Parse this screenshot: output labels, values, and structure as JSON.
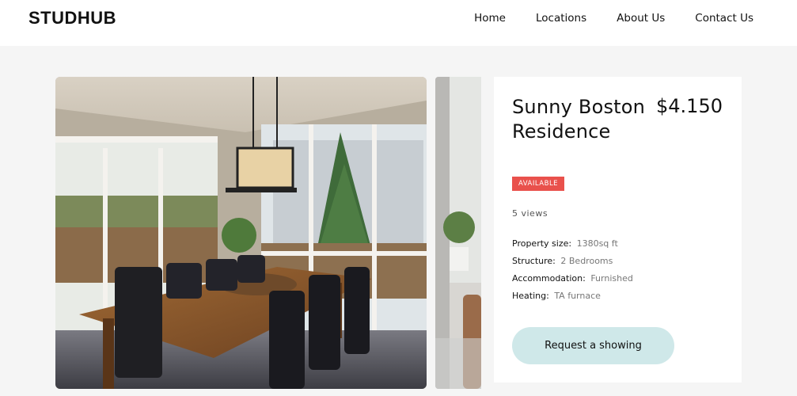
{
  "header": {
    "logo": "STUDHUB",
    "nav": [
      "Home",
      "Locations",
      "About Us",
      "Contact Us"
    ]
  },
  "listing": {
    "title": "Sunny Boston Residence",
    "price": "$4.150",
    "status": "AVAILABLE",
    "views": "5 views",
    "properties": [
      {
        "label": "Property size:",
        "value": "1380sq ft"
      },
      {
        "label": "Structure:",
        "value": "2 Bedrooms"
      },
      {
        "label": "Accommodation:",
        "value": "Furnished"
      },
      {
        "label": "Heating:",
        "value": "TA furnace"
      }
    ],
    "cta": "Request a showing"
  },
  "colors": {
    "badge": "#e9514c",
    "cta": "#cfe8e9",
    "background": "#f5f5f5"
  }
}
